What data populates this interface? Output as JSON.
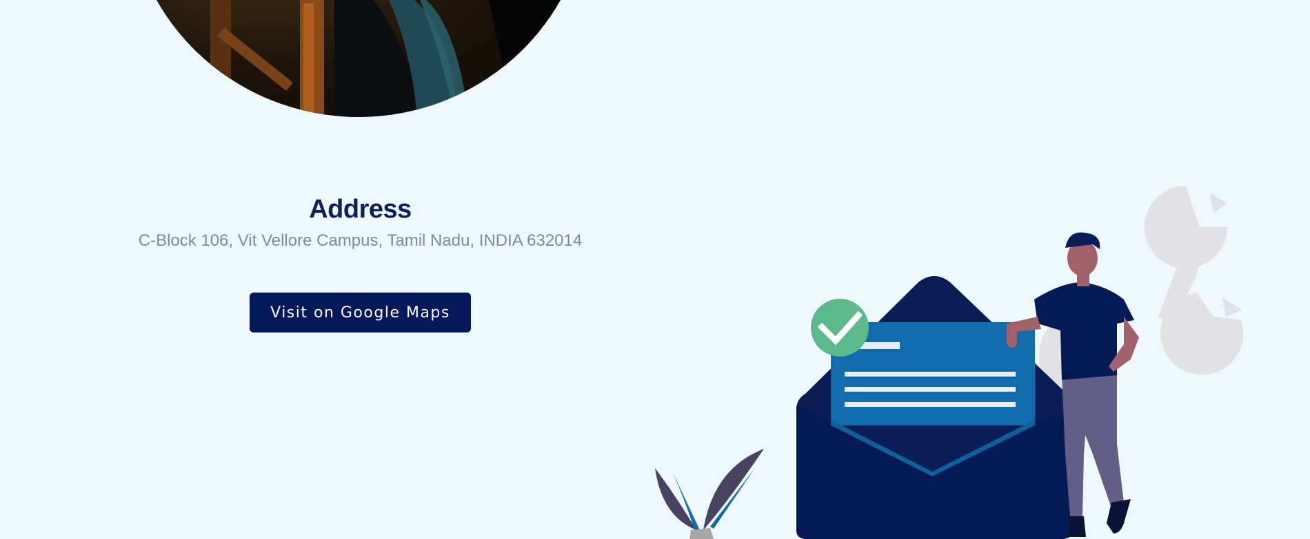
{
  "address": {
    "title": "Address",
    "text": "C-Block 106, Vit Vellore Campus, Tamil Nadu, INDIA 632014",
    "maps_button_label": "Visit on Google Maps"
  },
  "colors": {
    "background": "#eef8fd",
    "navy": "#05195a",
    "title": "#0d1f5c",
    "muted_text": "#7d8aa2",
    "letter_blue": "#126cab",
    "check_green": "#5bb98c"
  },
  "icons": {
    "check": "check-circle-icon",
    "envelope": "envelope-icon"
  }
}
